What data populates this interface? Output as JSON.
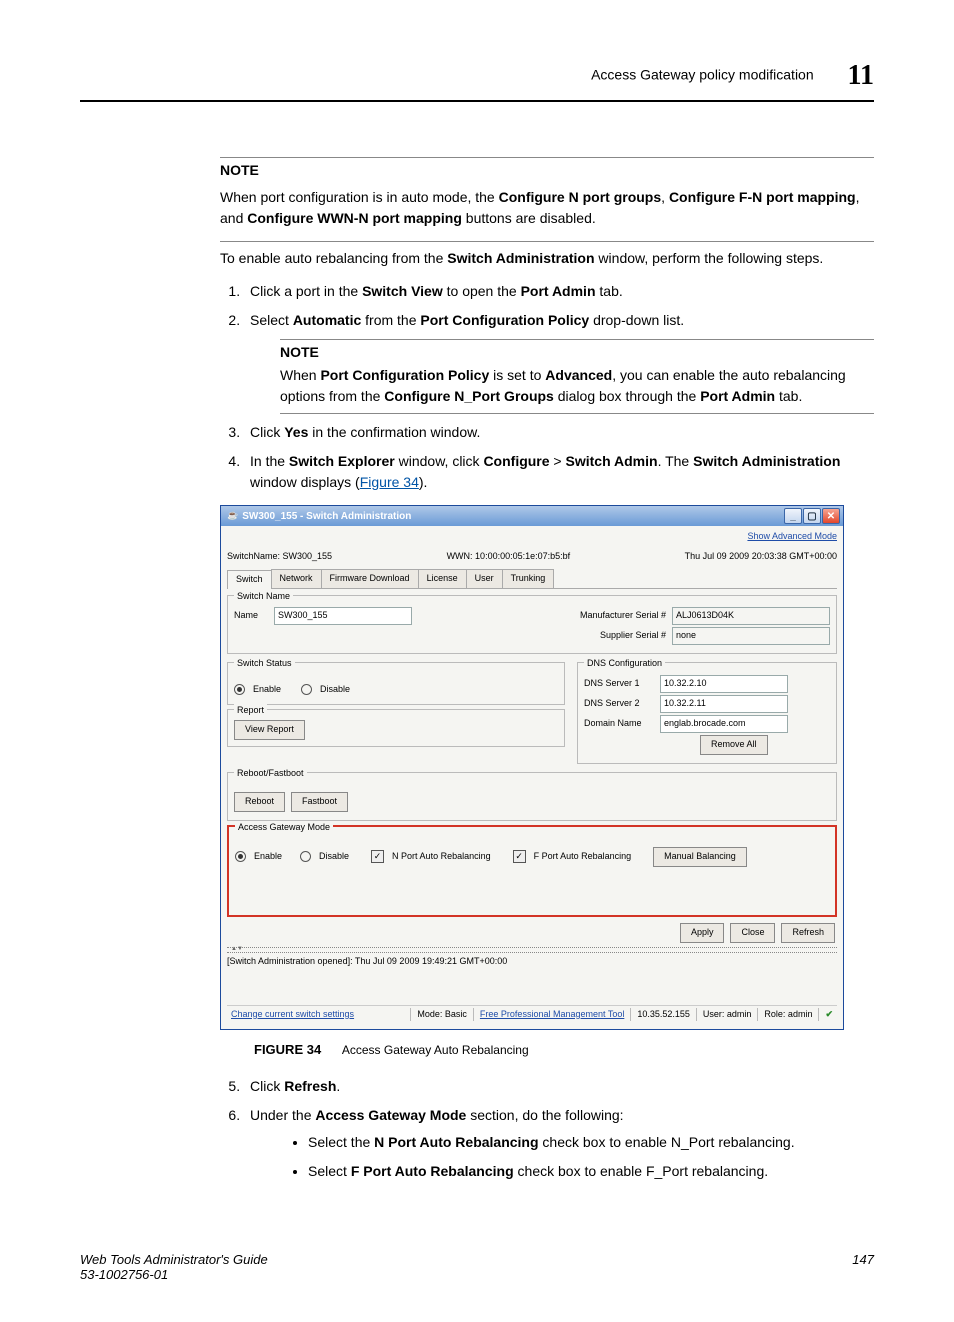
{
  "header": {
    "section": "Access Gateway policy modification",
    "chapter": "11"
  },
  "note1": {
    "title": "NOTE",
    "text1": "When port configuration is in auto mode, the ",
    "b1": "Configure N port groups",
    "t2": ", ",
    "b2": "Configure F-N port mapping",
    "t3": ", and ",
    "b3": "Configure WWN-N port mapping",
    "t4": " buttons are disabled."
  },
  "intro": {
    "t1": "To enable auto rebalancing from the ",
    "b1": "Switch Administration",
    "t2": " window, perform the following steps."
  },
  "step1": {
    "t1": "Click a port in the ",
    "b1": "Switch View",
    "t2": " to open the ",
    "b2": "Port Admin",
    "t3": " tab."
  },
  "step2": {
    "t1": "Select ",
    "b1": "Automatic",
    "t2": " from the ",
    "b2": "Port Configuration Policy",
    "t3": " drop-down list."
  },
  "note2": {
    "title": "NOTE",
    "t1": "When ",
    "b1": "Port Configuration Policy",
    "t2": " is set to ",
    "b2": "Advanced",
    "t3": ", you can enable the auto rebalancing options from the ",
    "b3": "Configure N_Port Groups",
    "t4": " dialog box through the ",
    "b4": "Port Admin",
    "t5": " tab."
  },
  "step3": {
    "t1": "Click ",
    "b1": "Yes",
    "t2": " in the confirmation window."
  },
  "step4": {
    "t1": "In the ",
    "b1": "Switch Explorer",
    "t2": " window, click ",
    "b2": "Configure",
    "t3": " > ",
    "b3": "Switch Admin",
    "t4": ". The ",
    "b4": "Switch Administration",
    "t5": " window displays (",
    "link": "Figure 34",
    "t6": ")."
  },
  "win": {
    "title": "SW300_155 - Switch Administration",
    "show_adv": "Show Advanced Mode",
    "switch_name_label": "SwitchName: SW300_155",
    "wwn_label": "WWN: 10:00:00:05:1e:07:b5:bf",
    "timestamp": "Thu Jul 09 2009 20:03:38 GMT+00:00",
    "tabs": {
      "switch": "Switch",
      "network": "Network",
      "fw": "Firmware Download",
      "license": "License",
      "user": "User",
      "trunking": "Trunking"
    },
    "g_switch_name": {
      "title": "Switch Name",
      "name_label": "Name",
      "name_value": "SW300_155",
      "mfg_label": "Manufacturer Serial #",
      "mfg_value": "ALJ0613D04K",
      "sup_label": "Supplier Serial #",
      "sup_value": "none"
    },
    "g_switch_status": {
      "title": "Switch Status",
      "enable": "Enable",
      "disable": "Disable"
    },
    "g_dns": {
      "title": "DNS Configuration",
      "s1_label": "DNS Server 1",
      "s1_value": "10.32.2.10",
      "s2_label": "DNS Server 2",
      "s2_value": "10.32.2.11",
      "dn_label": "Domain Name",
      "dn_value": "englab.brocade.com",
      "remove_all": "Remove All"
    },
    "g_report": {
      "title": "Report",
      "view": "View Report"
    },
    "g_reboot": {
      "title": "Reboot/Fastboot",
      "reboot": "Reboot",
      "fastboot": "Fastboot"
    },
    "g_agm": {
      "title": "Access Gateway Mode",
      "enable": "Enable",
      "disable": "Disable",
      "nport": "N Port Auto Rebalancing",
      "fport": "F Port Auto Rebalancing",
      "manual": "Manual Balancing"
    },
    "btns": {
      "apply": "Apply",
      "close": "Close",
      "refresh": "Refresh"
    },
    "log": "[Switch Administration opened]: Thu Jul 09 2009 19:49:21 GMT+00:00",
    "status": {
      "change": "Change current switch settings",
      "mode": "Mode: Basic",
      "tool": "Free Professional Management Tool",
      "ip": "10.35.52.155",
      "user": "User: admin",
      "role": "Role: admin"
    }
  },
  "figure": {
    "label": "FIGURE 34",
    "caption": "Access Gateway Auto Rebalancing"
  },
  "step5": {
    "t1": "Click ",
    "b1": "Refresh",
    "t2": "."
  },
  "step6": {
    "t1": "Under the ",
    "b1": "Access Gateway Mode",
    "t2": " section, do the following:"
  },
  "bullet1": {
    "t1": "Select the ",
    "b1": "N Port Auto Rebalancing",
    "t2": " check box to enable N_Port rebalancing."
  },
  "bullet2": {
    "t1": "Select ",
    "b1": "F Port Auto Rebalancing",
    "t2": " check box to enable F_Port rebalancing."
  },
  "footer": {
    "guide": "Web Tools Administrator's Guide",
    "docnum": "53-1002756-01",
    "page": "147"
  }
}
